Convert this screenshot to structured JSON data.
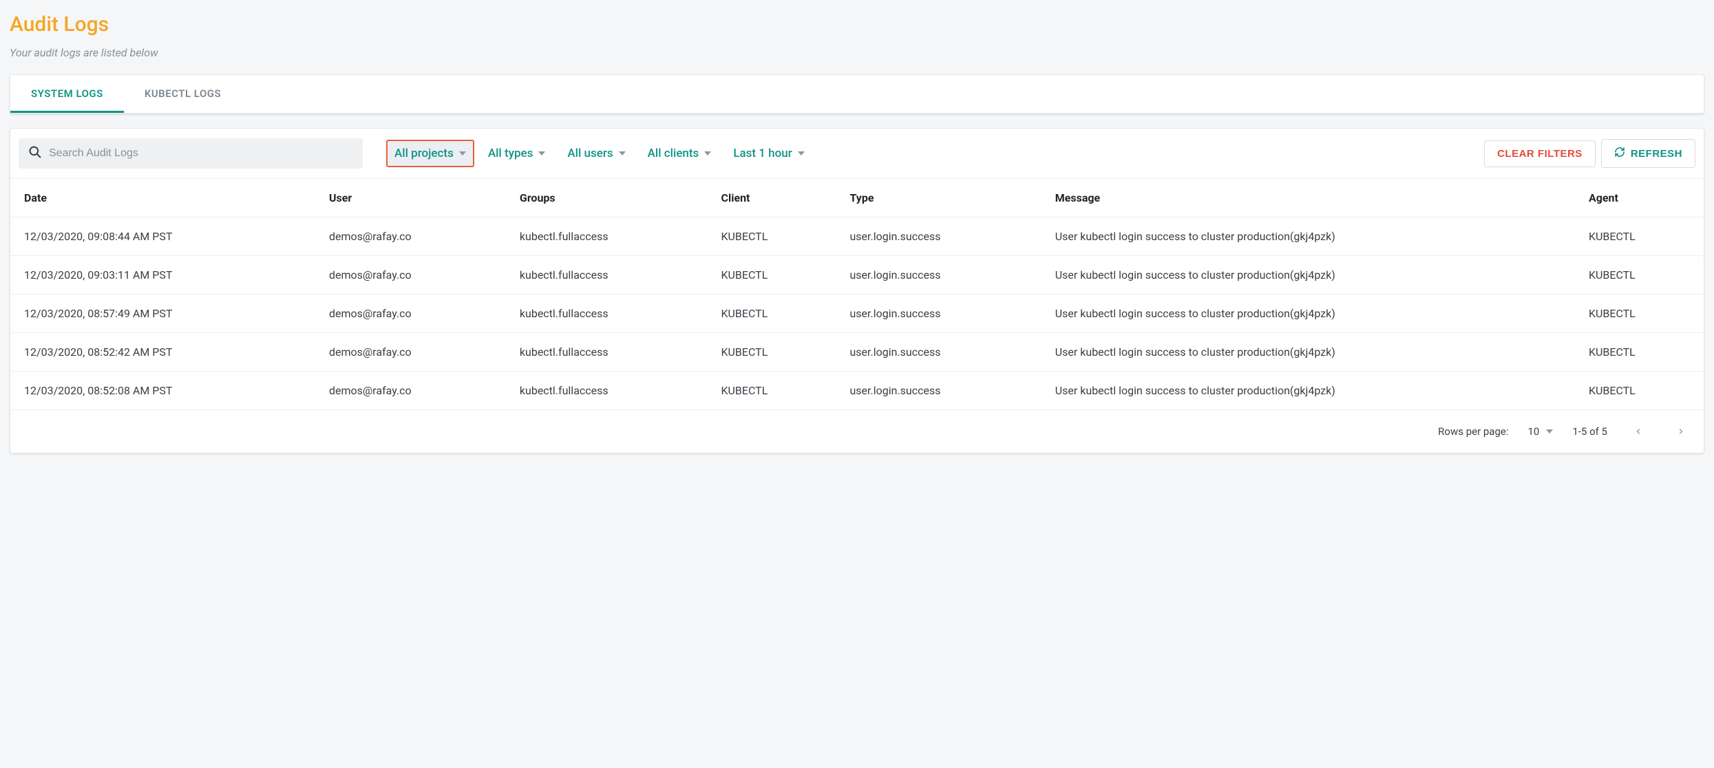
{
  "header": {
    "title": "Audit Logs",
    "subtitle": "Your audit logs are listed below"
  },
  "tabs": [
    {
      "label": "SYSTEM LOGS",
      "active": true
    },
    {
      "label": "KUBECTL LOGS",
      "active": false
    }
  ],
  "toolbar": {
    "search_placeholder": "Search Audit Logs",
    "filters": {
      "projects": "All projects",
      "types": "All types",
      "users": "All users",
      "clients": "All clients",
      "time": "Last 1 hour"
    },
    "clear_label": "CLEAR FILTERS",
    "refresh_label": "REFRESH"
  },
  "table": {
    "columns": [
      "Date",
      "User",
      "Groups",
      "Client",
      "Type",
      "Message",
      "Agent"
    ],
    "rows": [
      {
        "date": "12/03/2020, 09:08:44 AM PST",
        "user": "demos@rafay.co",
        "groups": "kubectl.fullaccess",
        "client": "KUBECTL",
        "type": "user.login.success",
        "message": "User kubectl login success to cluster production(gkj4pzk)",
        "agent": "KUBECTL"
      },
      {
        "date": "12/03/2020, 09:03:11 AM PST",
        "user": "demos@rafay.co",
        "groups": "kubectl.fullaccess",
        "client": "KUBECTL",
        "type": "user.login.success",
        "message": "User kubectl login success to cluster production(gkj4pzk)",
        "agent": "KUBECTL"
      },
      {
        "date": "12/03/2020, 08:57:49 AM PST",
        "user": "demos@rafay.co",
        "groups": "kubectl.fullaccess",
        "client": "KUBECTL",
        "type": "user.login.success",
        "message": "User kubectl login success to cluster production(gkj4pzk)",
        "agent": "KUBECTL"
      },
      {
        "date": "12/03/2020, 08:52:42 AM PST",
        "user": "demos@rafay.co",
        "groups": "kubectl.fullaccess",
        "client": "KUBECTL",
        "type": "user.login.success",
        "message": "User kubectl login success to cluster production(gkj4pzk)",
        "agent": "KUBECTL"
      },
      {
        "date": "12/03/2020, 08:52:08 AM PST",
        "user": "demos@rafay.co",
        "groups": "kubectl.fullaccess",
        "client": "KUBECTL",
        "type": "user.login.success",
        "message": "User kubectl login success to cluster production(gkj4pzk)",
        "agent": "KUBECTL"
      }
    ]
  },
  "pagination": {
    "rows_label": "Rows per page:",
    "rows_per_page": "10",
    "range": "1-5 of 5"
  }
}
